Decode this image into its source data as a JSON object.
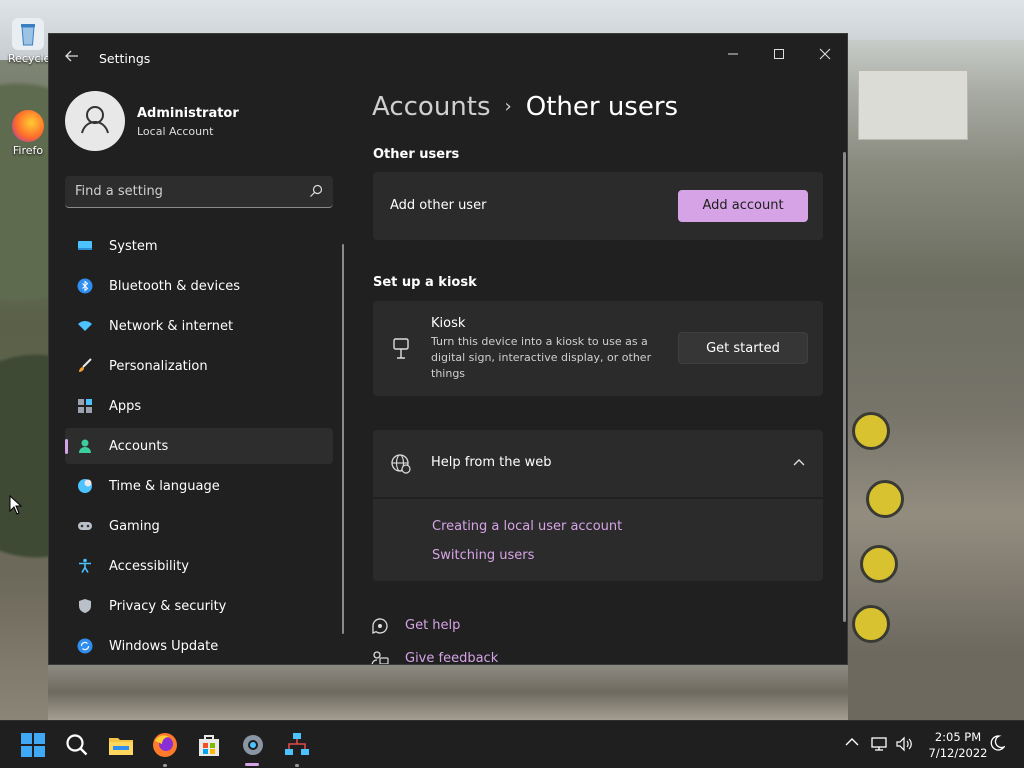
{
  "desktop": {
    "icons": [
      {
        "label": "Recycle",
        "icon": "recycle-bin-icon"
      },
      {
        "label": "Firefo",
        "icon": "firefox-icon"
      }
    ]
  },
  "window": {
    "title": "Settings",
    "controls": {
      "minimize": "minimize-icon",
      "maximize": "maximize-icon",
      "close": "close-icon"
    }
  },
  "profile": {
    "name": "Administrator",
    "account_type": "Local Account"
  },
  "search": {
    "placeholder": "Find a setting",
    "value": ""
  },
  "sidebar": {
    "items": [
      {
        "label": "System",
        "icon": "system-icon",
        "selected": false
      },
      {
        "label": "Bluetooth & devices",
        "icon": "bluetooth-icon",
        "selected": false
      },
      {
        "label": "Network & internet",
        "icon": "network-icon",
        "selected": false
      },
      {
        "label": "Personalization",
        "icon": "brush-icon",
        "selected": false
      },
      {
        "label": "Apps",
        "icon": "apps-icon",
        "selected": false
      },
      {
        "label": "Accounts",
        "icon": "accounts-icon",
        "selected": true
      },
      {
        "label": "Time & language",
        "icon": "time-language-icon",
        "selected": false
      },
      {
        "label": "Gaming",
        "icon": "gaming-icon",
        "selected": false
      },
      {
        "label": "Accessibility",
        "icon": "accessibility-icon",
        "selected": false
      },
      {
        "label": "Privacy & security",
        "icon": "shield-icon",
        "selected": false
      },
      {
        "label": "Windows Update",
        "icon": "update-icon",
        "selected": false
      }
    ]
  },
  "main": {
    "breadcrumb": {
      "parent": "Accounts",
      "separator": "›",
      "current": "Other users"
    },
    "other_users": {
      "section_title": "Other users",
      "add_label": "Add other user",
      "add_button": "Add account"
    },
    "kiosk": {
      "section_title": "Set up a kiosk",
      "title": "Kiosk",
      "description": "Turn this device into a kiosk to use as a digital sign, interactive display, or other things",
      "button": "Get started"
    },
    "help": {
      "title": "Help from the web",
      "links": [
        "Creating a local user account",
        "Switching users"
      ]
    },
    "footer": {
      "get_help": "Get help",
      "give_feedback": "Give feedback"
    }
  },
  "taskbar": {
    "apps": [
      "start-icon",
      "search-icon",
      "file-explorer-icon",
      "firefox-icon",
      "store-icon",
      "settings-icon",
      "network-tool-icon"
    ],
    "clock": {
      "time": "2:05 PM",
      "date": "7/12/2022"
    }
  },
  "colors": {
    "accent": "#d6a4e6",
    "window_bg": "#202020",
    "card_bg": "#2b2b2b",
    "taskbar_bg": "#1f1f1f"
  }
}
